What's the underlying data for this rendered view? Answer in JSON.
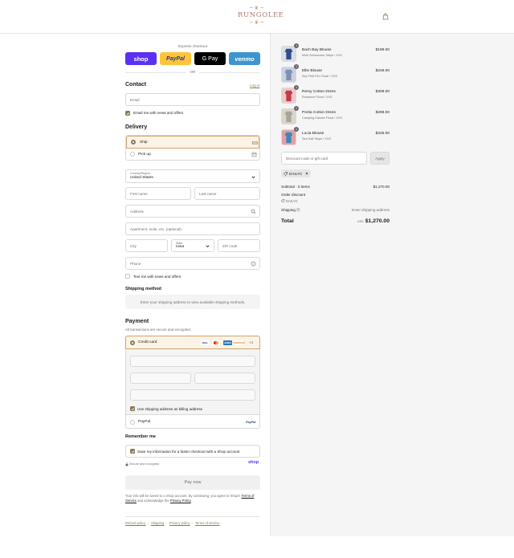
{
  "brand": {
    "name": "RUNGOLEE",
    "ornament": "~❦~"
  },
  "express": {
    "label": "Express checkout",
    "buttons": [
      "shop",
      "PayPal",
      "G Pay",
      "venmo"
    ],
    "or": "OR"
  },
  "contact": {
    "title": "Contact",
    "login": "Log in",
    "email_placeholder": "Email",
    "email_news": "Email me with news and offers"
  },
  "delivery": {
    "title": "Delivery",
    "options": [
      "Ship",
      "Pick up"
    ],
    "country_label": "Country/Region",
    "country_value": "United States",
    "first_name": "First name",
    "last_name": "Last name",
    "address": "Address",
    "apartment": "Apartment, suite, etc. (optional)",
    "city": "City",
    "state_label": "State",
    "state_value": "Iowa",
    "zip": "ZIP code",
    "phone": "Phone",
    "text_news": "Text me with news and offers"
  },
  "shipping_method": {
    "title": "Shipping method",
    "notice": "Enter your shipping address to view available shipping methods."
  },
  "payment": {
    "title": "Payment",
    "subtitle": "All transactions are secure and encrypted.",
    "credit_card": "Credit card",
    "cards": [
      "VISA",
      "MC",
      "AMEX",
      "DISCOVER"
    ],
    "more": "+4",
    "billing_same": "Use shipping address as billing address",
    "paypal": "PayPal",
    "paypal_logo": "PayPal"
  },
  "remember": {
    "title": "Remember me",
    "save": "Save my information for a faster checkout with a Shop account",
    "secure": "Secure and encrypted",
    "shop_logo": "shop"
  },
  "pay_now": "Pay now",
  "legal": {
    "text": "Your info will be saved to a Shop account. By continuing, you agree to Shop's",
    "terms": "Terms of Service",
    "mid": "and acknowledge the",
    "privacy": "Privacy Policy",
    "end": "."
  },
  "footer_links": [
    "Refund policy",
    "Shipping",
    "Privacy policy",
    "Terms of service"
  ],
  "cart": {
    "items": [
      {
        "name": "Bach Bay Blouse",
        "variant": "Multi Seersucker Stripe / XXS",
        "price": "$189.00",
        "qty": "1",
        "color": "#2f4e8a",
        "accent": "#d9dde8"
      },
      {
        "name": "Ellie Blouse",
        "variant": "Sky Petit Fen Floral / XXS",
        "price": "$248.00",
        "qty": "1",
        "color": "#7f8fb3",
        "accent": "#c9d0e2"
      },
      {
        "name": "Remy Cotton Dress",
        "variant": "Romance Floral / XXS",
        "price": "$309.00",
        "qty": "1",
        "color": "#c23a4a",
        "accent": "#f0c8c8"
      },
      {
        "name": "Portia Cotton Dress",
        "variant": "Camping Daisies Floral / XXS",
        "price": "$298.00",
        "qty": "1",
        "color": "#a7a59d",
        "accent": "#d9d5c8"
      },
      {
        "name": "Lucia Blouse",
        "variant": "Sea Salt Stripe / XXS",
        "price": "$226.00",
        "qty": "1",
        "color": "#3e89b8",
        "accent": "#e2a0a6"
      }
    ],
    "discount_placeholder": "Discount code or gift card",
    "apply": "Apply",
    "code": "DAILYC",
    "subtotal_label": "Subtotal · 5 items",
    "subtotal": "$1,270.00",
    "order_discount": "Order discount",
    "discount_code": "DAILYC",
    "shipping_label": "Shipping",
    "shipping_value": "Enter shipping address",
    "total_label": "Total",
    "currency": "USD",
    "total": "$1,270.00"
  },
  "colors": {
    "accent": "#8a7a57",
    "selected_bg": "#fbf3e6",
    "selected_border": "#d0a56e",
    "summary_bg": "#f5f5f5"
  }
}
